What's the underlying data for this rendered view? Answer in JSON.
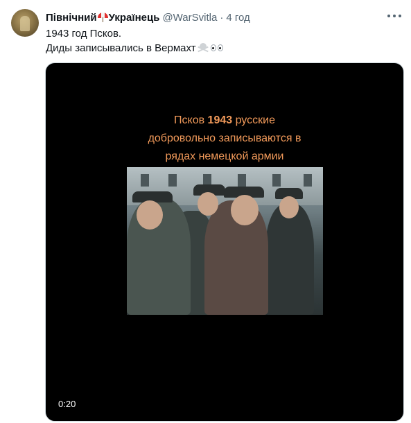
{
  "tweet": {
    "display_name_part1": "Північний",
    "display_name_part2": "Українець",
    "handle": "@WarSvitla",
    "separator": "·",
    "time": "4 год",
    "text_line1": "1943 год Псков.",
    "text_line2": "Диды записывались в Вермахт",
    "emoji_after_name": "umbrella-icon",
    "emoji_after_text": [
      "skull-crossbones-icon",
      "eyes-icon"
    ]
  },
  "video": {
    "caption_line1_a": "Псков ",
    "caption_line1_year": "1943",
    "caption_line1_b": " русские",
    "caption_line2": "добровольно записываются  в",
    "caption_line3": "рядах немецкой армии",
    "duration": "0:20",
    "caption_color": "#f29a5a"
  },
  "colors": {
    "text_primary": "#0f1419",
    "text_secondary": "#536471",
    "media_bg": "#000000"
  }
}
